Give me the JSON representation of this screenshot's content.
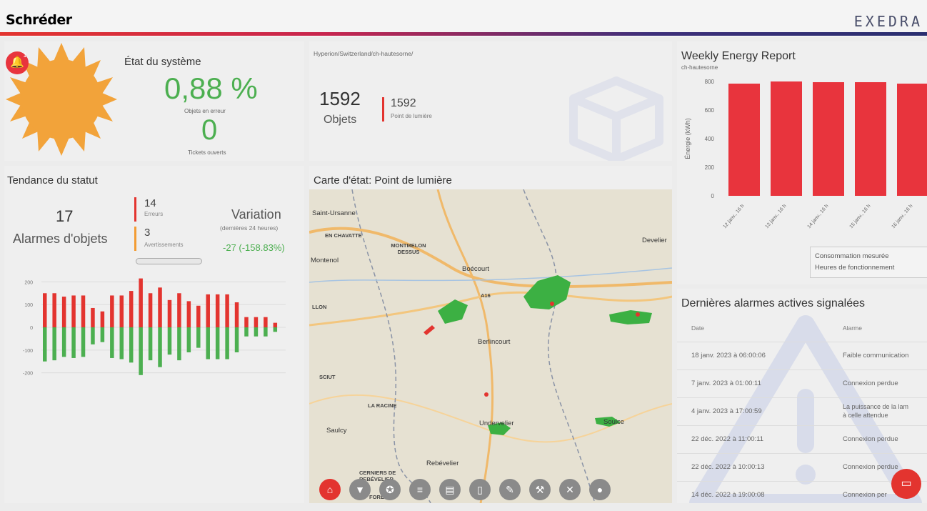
{
  "header": {
    "brand": "Schréder",
    "logo": "EXEDRA"
  },
  "etat": {
    "title": "État du système",
    "notification_count": "1",
    "percent_error": "0,88 %",
    "percent_label": "Objets en erreur",
    "tickets": "0",
    "tickets_label": "Tickets ouverts"
  },
  "objets": {
    "path": "Hyperion/Switzerland/ch-hautesorne/",
    "count": "1592",
    "count_label": "Objets",
    "lights": "1592",
    "lights_label": "Point de lumière"
  },
  "tendance": {
    "title": "Tendance du statut",
    "alarms": "17",
    "alarms_label": "Alarmes d'objets",
    "errors": "14",
    "errors_label": "Erreurs",
    "warnings": "3",
    "warnings_label": "Avertissements",
    "variation_title": "Variation",
    "variation_sub": "(dernières 24 heures)",
    "variation_value": "-27 (-158.83%)",
    "colors": {
      "error": "#e3342f",
      "warning": "#f39c33",
      "positive": "#4caf50"
    }
  },
  "map": {
    "title": "Carte d'état: Point de lumière",
    "labels": [
      "Saint-Ursanne",
      "EN CHAVATTE",
      "MONTMELON DESSUS",
      "Montenol",
      "Boécourt",
      "Develier",
      "A16",
      "LLON",
      "Berlincourt",
      "SCIUT",
      "LA RACINE",
      "Undervelier",
      "Soulce",
      "Saulcy",
      "Rebévelier",
      "CERNIERS DE REBÉVELIER",
      "FORÊT"
    ],
    "toolbar_icons": [
      "home-icon",
      "filter-icon",
      "bulb-icon",
      "list-icon",
      "chart-icon",
      "device-icon",
      "wrench-icon",
      "construction-icon",
      "satellite-icon",
      "user-icon"
    ]
  },
  "chart_data": [
    {
      "type": "bar",
      "title": "Weekly Energy Report",
      "subtitle": "ch-hautesorne",
      "ylabel": "Énergie (kWh)",
      "xlabel": "",
      "categories": [
        "12 janv., 16 h",
        "13 janv., 16 h",
        "14 janv., 16 h",
        "15 janv., 16 h",
        "16 janv., 16 h"
      ],
      "values": [
        785,
        800,
        795,
        795,
        785
      ],
      "ylim": [
        0,
        800
      ],
      "yticks": [
        0,
        200,
        400,
        600,
        800
      ],
      "color": "#e8343d",
      "legend": [
        "Consommation mesurée",
        "Heures de fonctionnement"
      ],
      "legend_position": "bottom-right"
    },
    {
      "type": "bar",
      "title": "",
      "yticks": [
        200,
        100,
        0,
        -100,
        -200
      ],
      "ylim": [
        -220,
        220
      ],
      "series": [
        {
          "values": [
            150,
            150,
            135,
            140,
            140,
            85,
            70,
            140,
            140,
            160,
            215,
            150,
            175,
            120,
            150,
            115,
            95,
            145,
            145,
            145,
            110,
            45,
            45,
            45,
            20
          ]
        },
        {
          "values": [
            -150,
            -145,
            -130,
            -135,
            -130,
            -75,
            -65,
            -135,
            -140,
            -155,
            -210,
            -145,
            -175,
            -120,
            -145,
            -110,
            -90,
            -140,
            -140,
            -140,
            -110,
            -40,
            -40,
            -40,
            -20
          ]
        }
      ],
      "colors": [
        "#e3342f",
        "#4caf50"
      ]
    }
  ],
  "alarms": {
    "title": "Dernières alarmes actives signalées",
    "col_date": "Date",
    "col_alarm": "Alarme",
    "rows": [
      {
        "date": "18 janv. 2023 à 06:00:06",
        "alarm": "Faible communication"
      },
      {
        "date": "7 janv. 2023 à 01:00:11",
        "alarm": "Connexion perdue"
      },
      {
        "date": "4 janv. 2023 à 17:00:59",
        "alarm": "La puissance de la lam",
        "alarm2": "à celle attendue"
      },
      {
        "date": "22 déc. 2022 à 11:00:11",
        "alarm": "Connexion perdue"
      },
      {
        "date": "22 déc. 2022 à 10:00:13",
        "alarm": "Connexion perdue"
      },
      {
        "date": "14 déc. 2022 à 19:00:08",
        "alarm": "Connexion per"
      }
    ]
  }
}
